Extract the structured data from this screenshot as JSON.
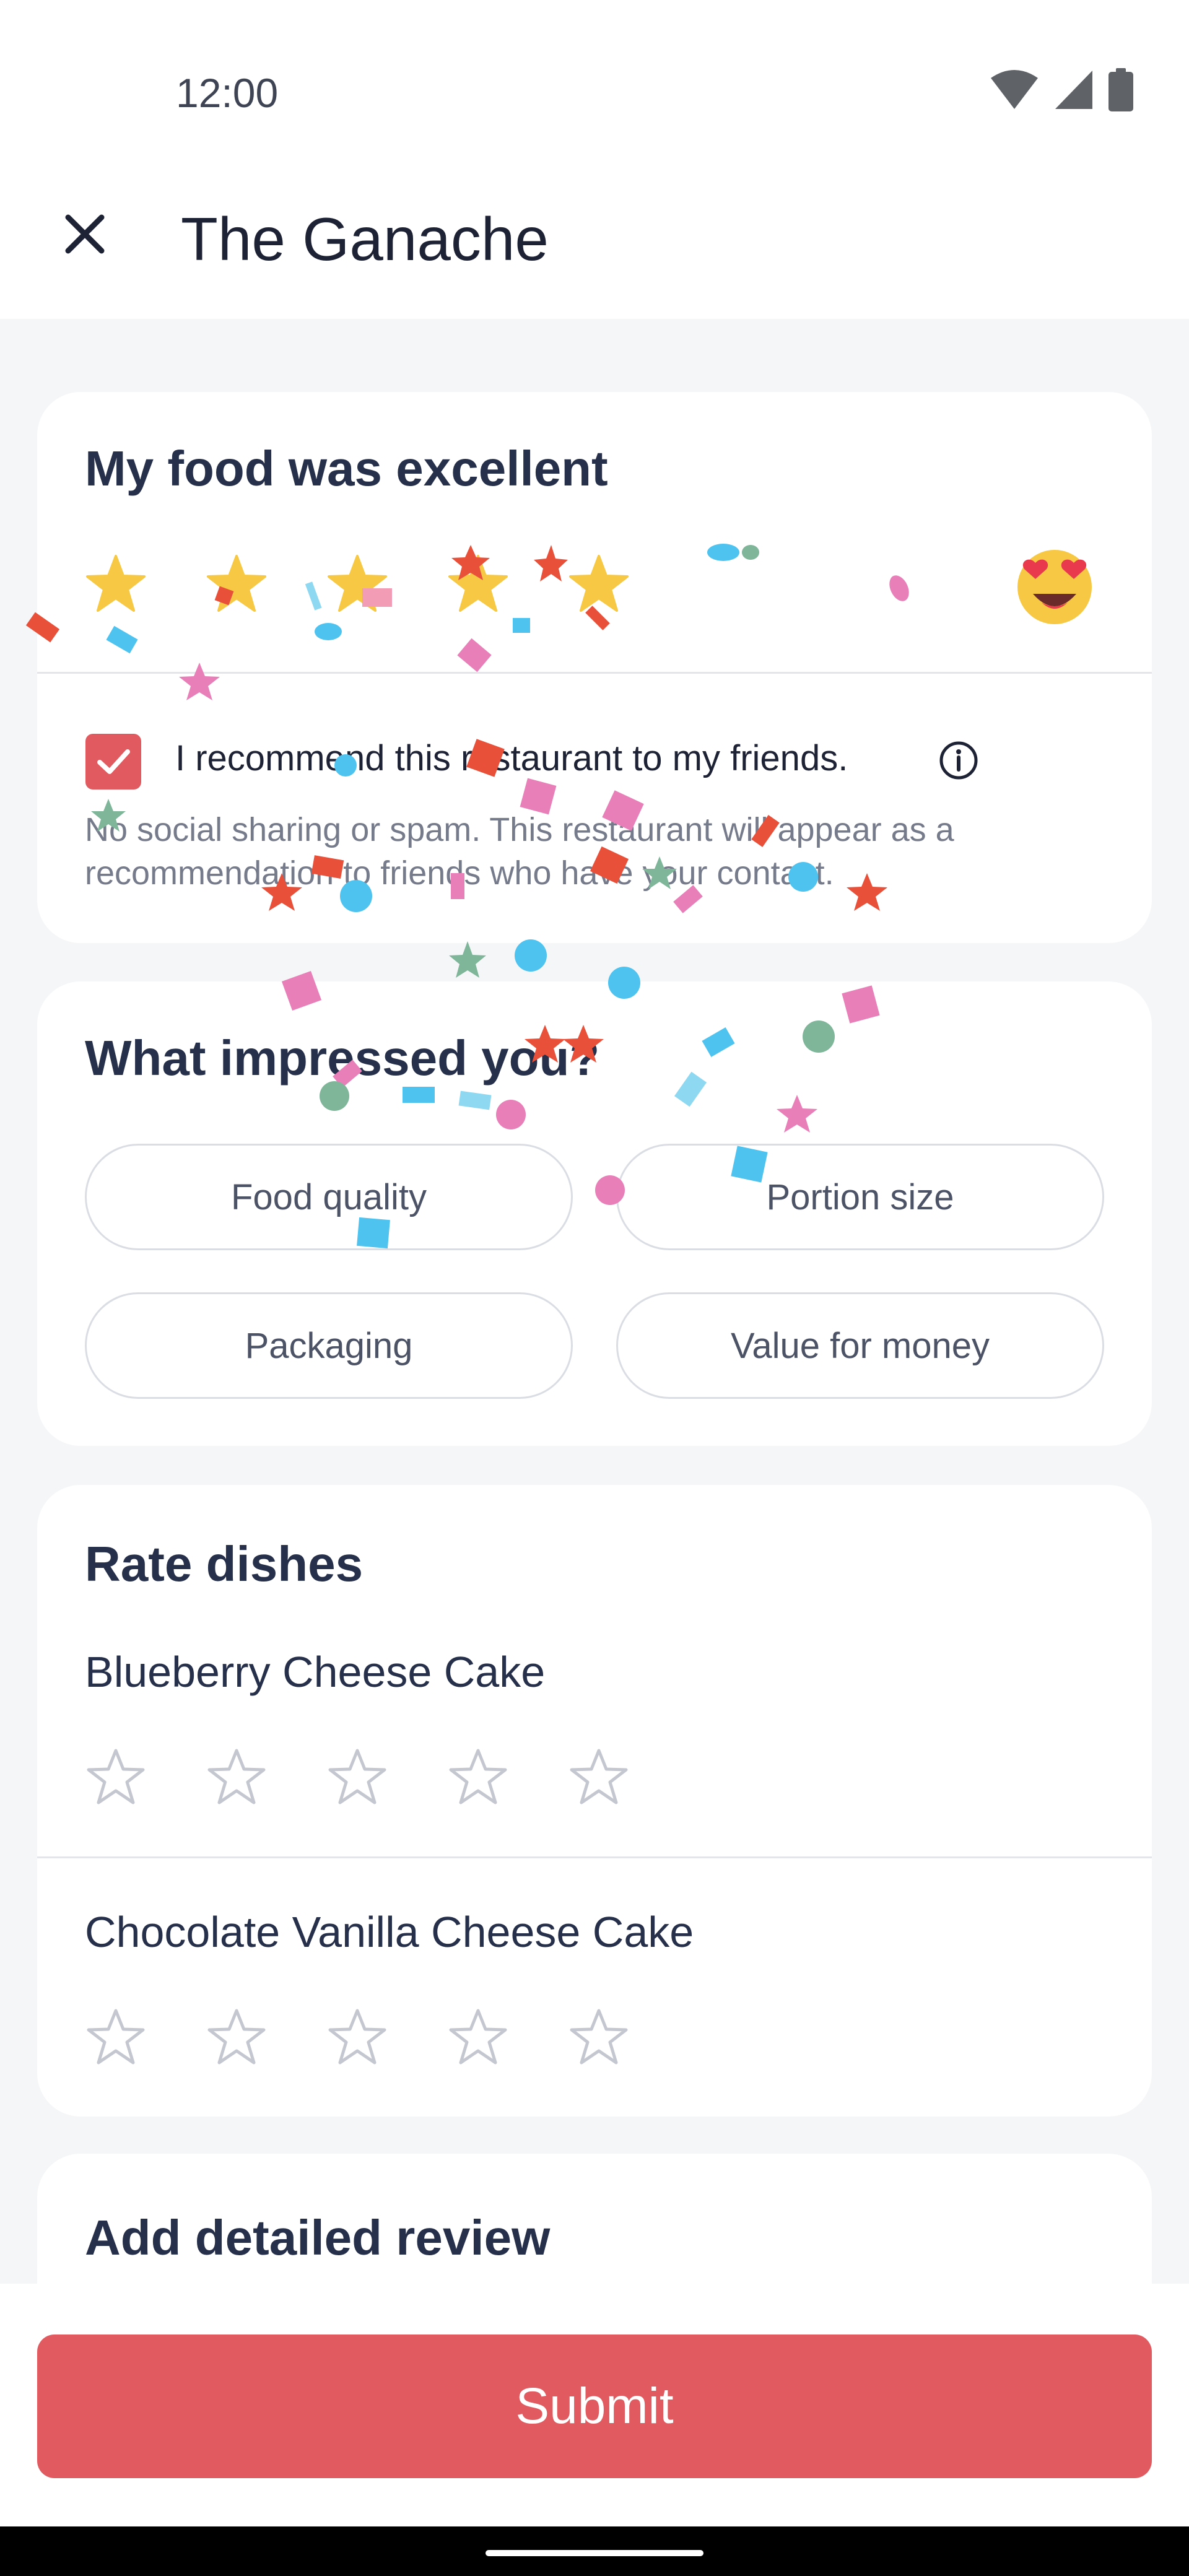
{
  "status_bar": {
    "time": "12:00",
    "icons": [
      "wifi-icon",
      "signal-icon",
      "battery-icon"
    ]
  },
  "app_bar": {
    "close_icon": "close-icon",
    "title": "The Ganache"
  },
  "overall_rating": {
    "title": "My food was excellent",
    "rating": 5,
    "max_rating": 5,
    "emoji": "star-struck-heart-eyes-emoji",
    "recommend": {
      "checked": true,
      "label": "I recommend this restaurant to my friends.",
      "info_icon": "info-icon",
      "disclaimer": "No social sharing or spam. This restaurant will appear as a recommendation to friends who have your contact."
    }
  },
  "impressed": {
    "title": "What impressed you?",
    "options": [
      {
        "label": "Food quality"
      },
      {
        "label": "Portion size"
      },
      {
        "label": "Packaging"
      },
      {
        "label": "Value for money"
      }
    ]
  },
  "rate_dishes": {
    "title": "Rate dishes",
    "dishes": [
      {
        "name": "Blueberry Cheese Cake",
        "rating": 0,
        "max_rating": 5
      },
      {
        "name": "Chocolate Vanilla Cheese Cake",
        "rating": 0,
        "max_rating": 5
      }
    ]
  },
  "detailed_review": {
    "title": "Add detailed review"
  },
  "submit": {
    "label": "Submit"
  },
  "colors": {
    "accent": "#E05A60",
    "star_filled": "#F7C843",
    "star_empty_stroke": "#C4C7CF"
  }
}
